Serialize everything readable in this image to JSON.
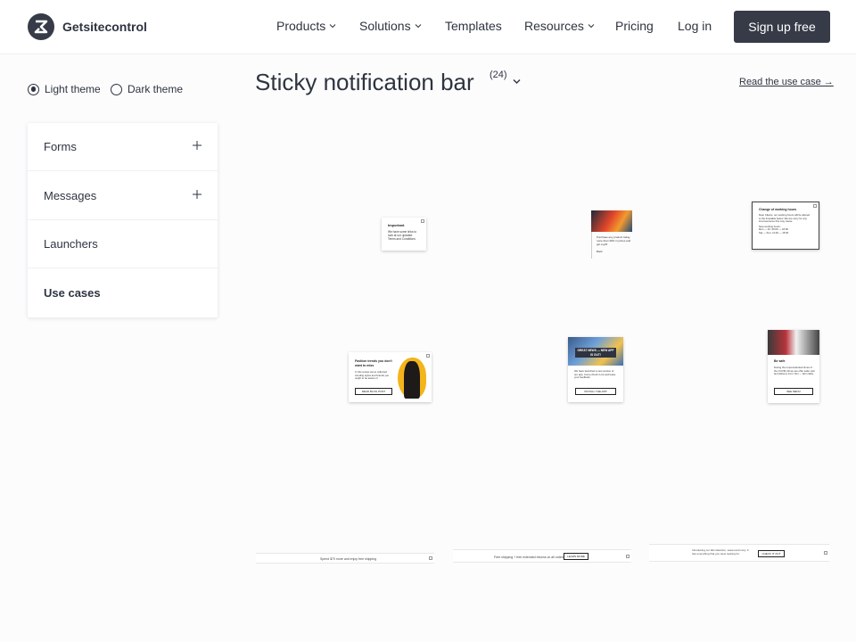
{
  "header": {
    "brand": "Getsitecontrol",
    "nav": [
      "Products",
      "Solutions",
      "Templates",
      "Resources",
      "Pricing",
      "Log in"
    ],
    "signup": "Sign up free"
  },
  "theme": {
    "light": "Light theme",
    "dark": "Dark theme",
    "selected": "light"
  },
  "sidebar": {
    "items": [
      {
        "label": "Forms"
      },
      {
        "label": "Messages"
      },
      {
        "label": "Launchers"
      },
      {
        "label": "Use cases"
      }
    ]
  },
  "main": {
    "title": "Sticky notification bar",
    "count": "(24)",
    "read_link": "Read the use case →"
  },
  "thumbs": {
    "important": {
      "title": "Important",
      "body": "We have some links to look at our updated Terms and Conditions"
    },
    "product": {
      "body": "Purchase any product today, more than 30% in prices and get a gift!",
      "link": "Back"
    },
    "hours": {
      "title": "Change of working hours",
      "body": "Dear Clients, our working hours will be altered to the timetable below. We are sorry for any inconvenience this may cause.",
      "line1": "New working hours:",
      "line2": "Mon — Fri: 09:00 — 18:00",
      "line3": "Sat — Sun: 11:00 — 15:00"
    },
    "fashion": {
      "title": "Fashion trends you don't want to miss",
      "body": "In this review we've collected trending styles and brands you ought to be aware of",
      "btn": "READ BLOG POST"
    },
    "app": {
      "banner": "GREAT NEWS — NEW APP IS OUT!",
      "body": "We have launched a new version of our app. Come check it out and leave your feedback.",
      "btn": "INSTALL THE APP"
    },
    "safe": {
      "title": "Be safe",
      "body": "During the unprecedented times of the COVID-19 we are offer safer visit and delivery from 7am — 9pm daily.",
      "btn": "SEE MENU"
    },
    "bar1": "Spend $70 more and enjoy free shipping",
    "bar2": "Free shipping + free extended returns on all orders",
    "bar2_btn": "LEARN MORE",
    "bar3": "Introducing our fall collection, sweet and cozy. It has everything that you were looking for.",
    "bar3_btn": "CHECK IT OUT"
  }
}
